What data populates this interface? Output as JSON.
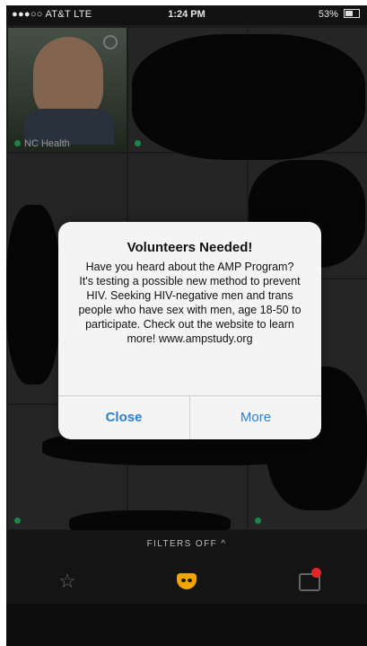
{
  "status_bar": {
    "carrier": "●●●○○ AT&T  LTE",
    "time": "1:24 PM",
    "battery": "53%"
  },
  "grid": {
    "tiles": [
      {
        "name": "NC Health"
      }
    ]
  },
  "alert": {
    "title": "Volunteers Needed!",
    "message": "Have you heard about the AMP Program? It's testing a possible new method to prevent HIV. Seeking HIV-negative men and trans people who have sex with men, age 18-50 to participate. Check out the website to learn more! www.ampstudy.org",
    "close_label": "Close",
    "more_label": "More"
  },
  "filters": {
    "label": "FILTERS OFF ^"
  },
  "tabbar": {
    "icons": [
      "star-icon",
      "mask-icon",
      "chat-icon"
    ],
    "accent_color": "#f0a500",
    "badge_color": "#e02828"
  }
}
